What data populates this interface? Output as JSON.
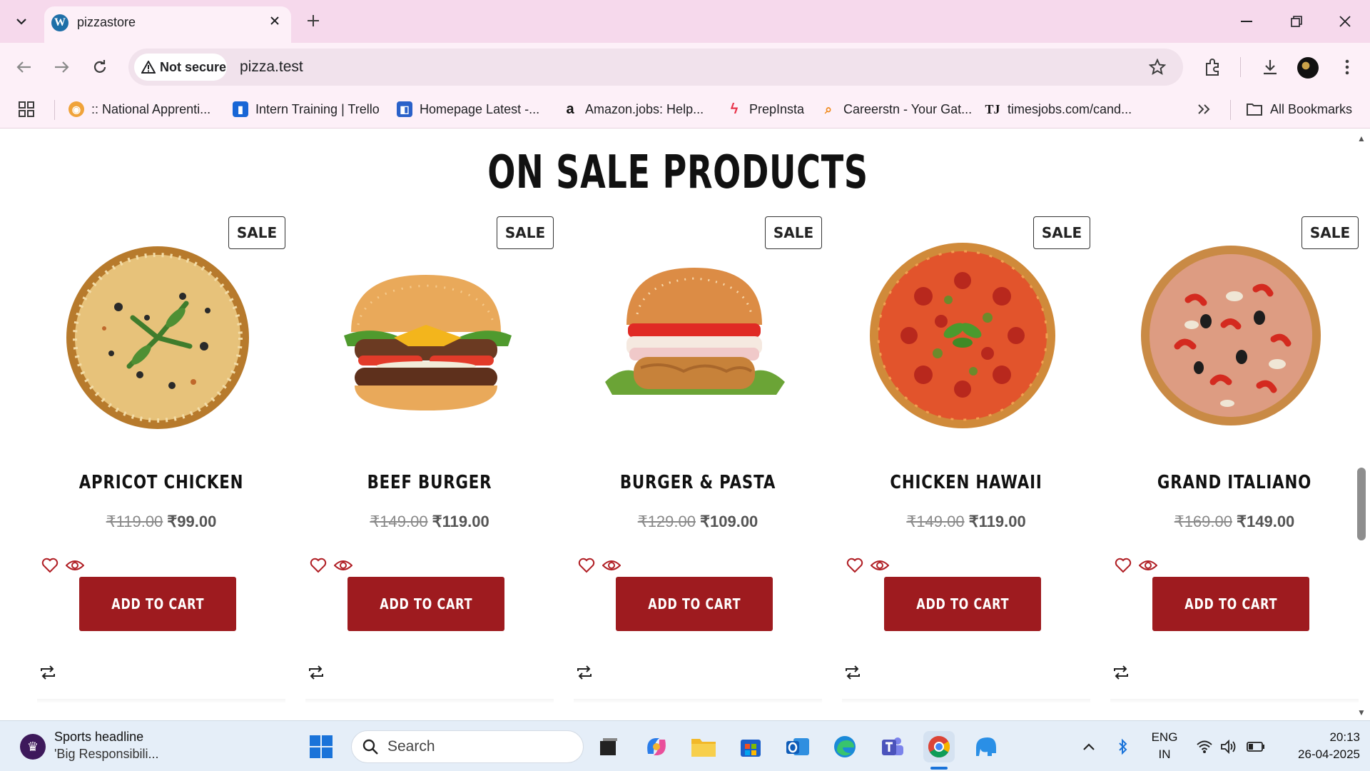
{
  "browser": {
    "tab_title": "pizzastore",
    "security_label": "Not secure",
    "url": "pizza.test",
    "bookmarks": [
      {
        "label": ":: National Apprenti...",
        "icon": "national-apprenticeship-icon",
        "color": "#f0a33a"
      },
      {
        "label": "Intern Training | Trello",
        "icon": "trello-icon",
        "color": "#1866d6"
      },
      {
        "label": "Homepage Latest -...",
        "icon": "homepage-icon",
        "color": "#2a61c9"
      },
      {
        "label": "Amazon.jobs: Help...",
        "icon": "amazon-icon",
        "color": "#111111"
      },
      {
        "label": "PrepInsta",
        "icon": "prepinsta-icon",
        "color": "#e8334a"
      },
      {
        "label": "Careerstn - Your Gat...",
        "icon": "careerstn-icon",
        "color": "#f08a1c"
      },
      {
        "label": "timesjobs.com/cand...",
        "icon": "timesjobs-icon",
        "color": "#111111"
      }
    ],
    "all_bookmarks_label": "All Bookmarks"
  },
  "page": {
    "section_title": "ON SALE PRODUCTS",
    "sale_label": "SALE",
    "add_to_cart_label": "ADD TO CART",
    "products": [
      {
        "name": "APRICOT CHICKEN",
        "old_price": "₹119.00",
        "new_price": "₹99.00",
        "image": "pizza-olive-icon"
      },
      {
        "name": "BEEF BURGER",
        "old_price": "₹149.00",
        "new_price": "₹119.00",
        "image": "beef-burger-icon"
      },
      {
        "name": "BURGER & PASTA",
        "old_price": "₹129.00",
        "new_price": "₹109.00",
        "image": "chicken-burger-icon"
      },
      {
        "name": "CHICKEN HAWAII",
        "old_price": "₹149.00",
        "new_price": "₹119.00",
        "image": "pepperoni-pizza-icon"
      },
      {
        "name": "GRAND ITALIANO",
        "old_price": "₹169.00",
        "new_price": "₹149.00",
        "image": "italiano-pizza-icon"
      }
    ]
  },
  "taskbar": {
    "news_title": "Sports headline",
    "news_subtitle": "'Big Responsibili...",
    "search_placeholder": "Search",
    "language": "ENG",
    "region": "IN",
    "time": "20:13",
    "date": "26-04-2025"
  },
  "colors": {
    "brand_red": "#9e1b1f",
    "titlebar_pink": "#f6d9ec",
    "toolbar_pink": "#fdf0f8"
  }
}
